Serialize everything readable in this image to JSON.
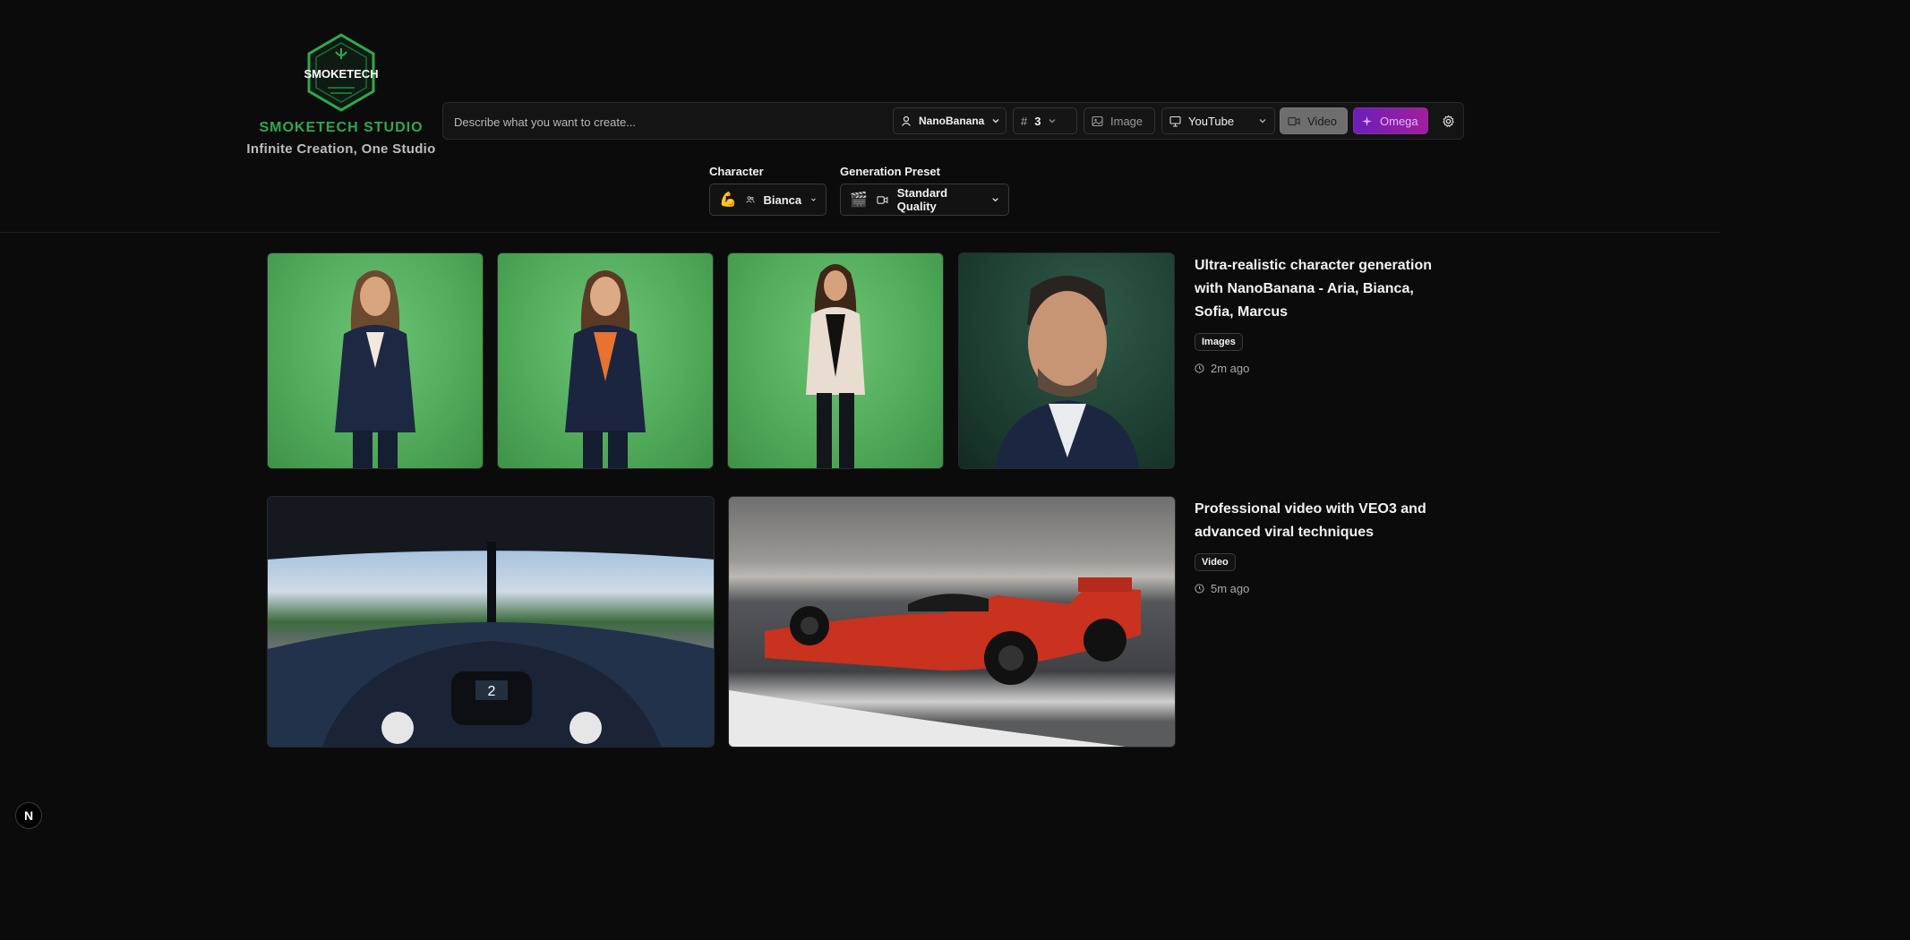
{
  "brand": {
    "logo_text": "SMOKETECH",
    "name": "SMOKETECH STUDIO",
    "tagline": "Infinite Creation, One Studio",
    "color": "#2fa84f"
  },
  "prompt_bar": {
    "placeholder": "Describe what you want to create...",
    "model": "NanoBanana",
    "count": "3",
    "image_label": "Image",
    "platform": "YouTube",
    "video_label": "Video",
    "omega_label": "Omega"
  },
  "character": {
    "label": "Character",
    "emoji": "💪",
    "value": "Bianca"
  },
  "preset": {
    "label": "Generation Preset",
    "emoji": "🎬",
    "value": "Standard Quality"
  },
  "feed": [
    {
      "title": "Ultra-realistic character generation with NanoBanana - Aria, Bianca, Sofia, Marcus",
      "tag": "Images",
      "time": "2m ago"
    },
    {
      "title": "Professional video with VEO3 and advanced viral techniques",
      "tag": "Video",
      "time": "5m ago"
    }
  ],
  "corner_badge": "N",
  "colors": {
    "background": "#0b0b0b",
    "accent_green": "#2fa84f",
    "omega_purple": "#8a2ab0"
  }
}
